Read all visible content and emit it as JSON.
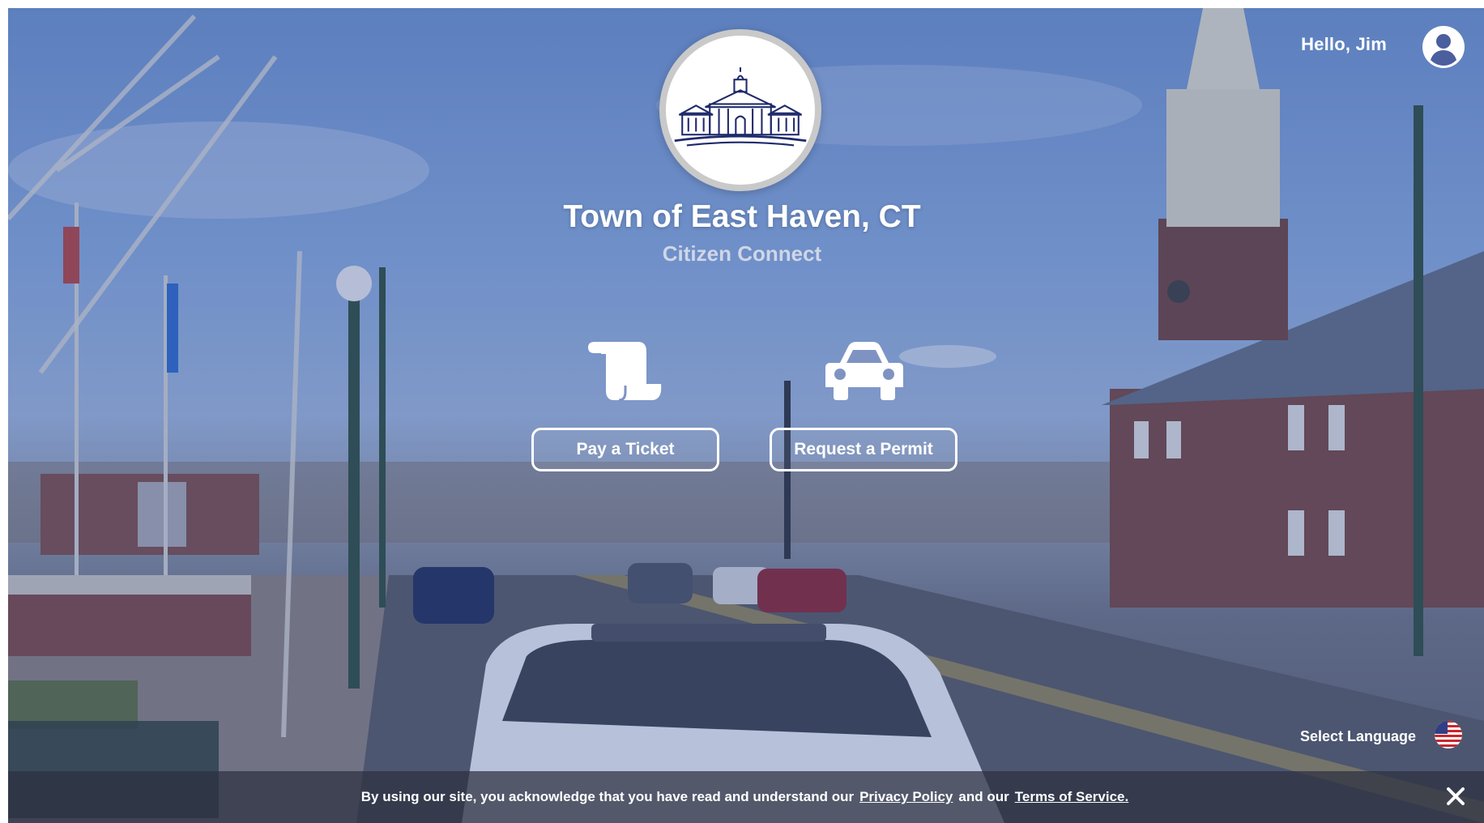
{
  "header": {
    "greeting": "Hello, Jim",
    "avatar_icon": "user-circle-icon"
  },
  "branding": {
    "seal_icon": "town-hall-seal",
    "title": "Town of East Haven, CT",
    "subtitle": "Citizen Connect"
  },
  "actions": [
    {
      "label": "Pay a Ticket",
      "icon": "scroll-icon"
    },
    {
      "label": "Request a Permit",
      "icon": "car-icon"
    }
  ],
  "language": {
    "label": "Select Language",
    "flag_icon": "us-flag-icon"
  },
  "cookie_notice": {
    "prefix": "By using our site, you acknowledge that you have read and understand our",
    "privacy_link": "Privacy Policy",
    "middle": "and our",
    "terms_link": "Terms of Service."
  },
  "colors": {
    "overlay": "#3755a0",
    "button_border": "#ffffff",
    "cookie_bar": "#2d3040"
  }
}
